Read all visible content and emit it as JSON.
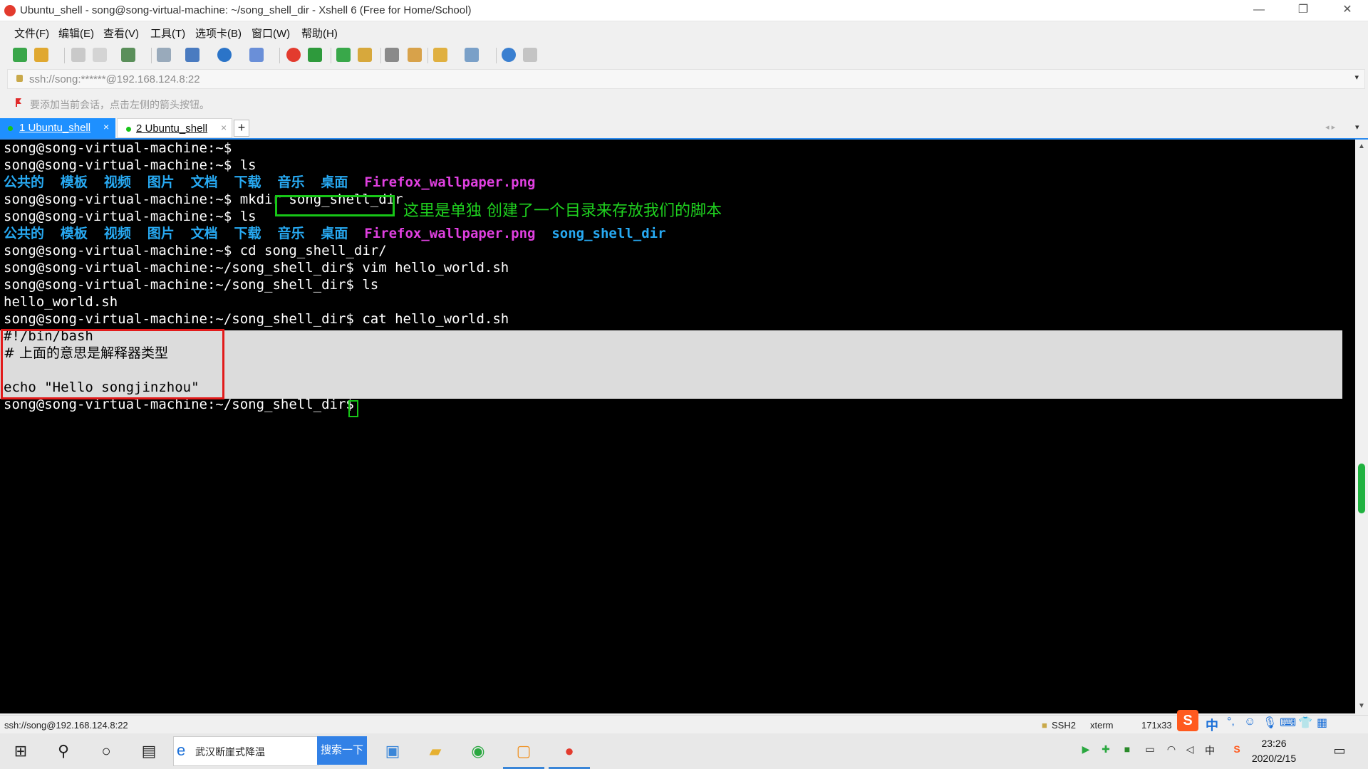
{
  "window": {
    "title": "Ubuntu_shell - song@song-virtual-machine: ~/song_shell_dir - Xshell 6 (Free for Home/School)",
    "minimize": "—",
    "maximize": "❐",
    "close": "✕"
  },
  "menu": [
    "文件(F)",
    "编辑(E)",
    "查看(V)",
    "工具(T)",
    "选项卡(B)",
    "窗口(W)",
    "帮助(H)"
  ],
  "address": {
    "value": "ssh://song:******@192.168.124.8:22",
    "dropdown": "▾"
  },
  "hint": "要添加当前会话，点击左侧的箭头按钮。",
  "tabs": [
    {
      "label": "1 Ubuntu_shell",
      "close": "×"
    },
    {
      "label": "2 Ubuntu_shell",
      "close": "×"
    }
  ],
  "tab_add": "+",
  "terminal": {
    "prompt_home": "song@song-virtual-machine:~$",
    "prompt_dir": "song@song-virtual-machine:~/song_shell_dir$",
    "cmd_ls": " ls",
    "cmd_mkdir": " mkdir ",
    "mkdir_arg": "song_shell_dir",
    "cmd_cd": " cd song_shell_dir/",
    "cmd_vim": " vim hello_world.sh",
    "cmd_cat": " cat hello_world.sh",
    "dirs": [
      "公共的",
      "模板",
      "视频",
      "图片",
      "文档",
      "下载",
      "音乐",
      "桌面"
    ],
    "image_file": "Firefox_wallpaper.png",
    "new_dir": "song_shell_dir",
    "ls_output": "hello_world.sh",
    "file_lines": [
      "#!/bin/bash",
      "# 上面的意思是解释器类型",
      "",
      "echo \"Hello songjinzhou\""
    ],
    "annotation": "这里是单独 创建了一个目录来存放我们的脚本"
  },
  "status": {
    "connection": "ssh://song@192.168.124.8:22",
    "protocol": "SSH2",
    "term": "xterm",
    "size": "171x33"
  },
  "taskbar": {
    "search_text": "武汉断崖式降温",
    "search_button": "搜索一下",
    "time": "23:26",
    "date": "2020/2/15",
    "ime_lang": "中"
  },
  "colors": {
    "tab_active": "#1e90ff",
    "dir": "#27a9f2",
    "image_file": "#e040e0",
    "annotation": "#1fd21f",
    "red_box": "#e21b1b"
  }
}
